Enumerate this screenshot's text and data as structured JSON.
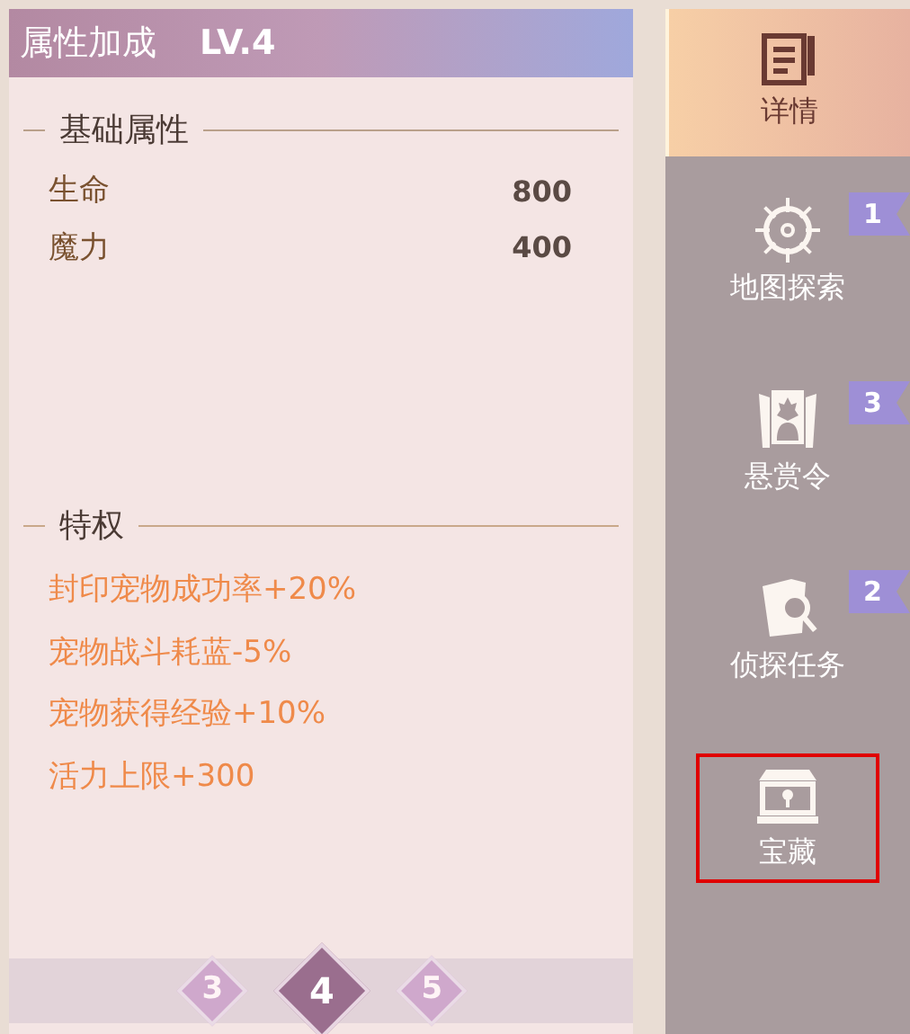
{
  "panel": {
    "title": "属性加成",
    "level_label": "LV.4"
  },
  "base_section": {
    "heading": "基础属性",
    "rows": [
      {
        "name": "生命",
        "value": "800"
      },
      {
        "name": "魔力",
        "value": "400"
      }
    ]
  },
  "privilege_section": {
    "heading": "特权",
    "items": [
      "封印宠物成功率+20%",
      "宠物战斗耗蓝-5%",
      "宠物获得经验+10%",
      "活力上限+300"
    ]
  },
  "level_pager": [
    {
      "label": "3",
      "selected": false
    },
    {
      "label": "4",
      "selected": true
    },
    {
      "label": "5",
      "selected": false
    }
  ],
  "side_tabs": [
    {
      "label": "详情",
      "selected": true,
      "highlighted": false
    },
    {
      "label": "地图探索",
      "selected": false,
      "badge": "1",
      "highlighted": false
    },
    {
      "label": "悬赏令",
      "selected": false,
      "badge": "3",
      "highlighted": false
    },
    {
      "label": "侦探任务",
      "selected": false,
      "badge": "2",
      "highlighted": false
    },
    {
      "label": "宝藏",
      "selected": false,
      "highlighted": true
    }
  ]
}
